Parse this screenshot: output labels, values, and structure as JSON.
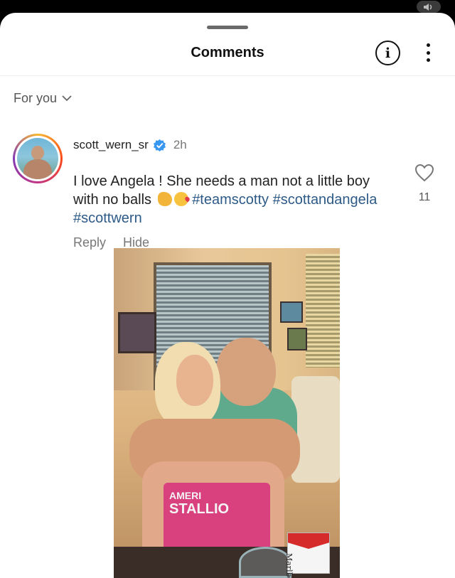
{
  "status_bar": {
    "volume_icon": "speaker-icon"
  },
  "header": {
    "title": "Comments",
    "info_icon_glyph": "i",
    "info_icon": "info-icon",
    "more_icon": "more-vertical-icon"
  },
  "filter": {
    "label": "For you",
    "icon": "chevron-down-icon"
  },
  "comment": {
    "username": "scott_wern_sr",
    "verified": true,
    "time": "2h",
    "text_line1": "I love Angela ! She needs a man not a little boy with no balls",
    "emojis": [
      "flexed-biceps",
      "face-blowing-kiss"
    ],
    "hashtags": [
      "#teamscotty",
      "#scottandangela",
      "#scottwern"
    ],
    "likes": "11",
    "reply_label": "Reply",
    "hide_label": "Hide"
  },
  "photo": {
    "shirt_text_line1": "AMERI",
    "shirt_text_line2": "STALLIO",
    "pack_text": "Marlboro"
  },
  "colors": {
    "hashtag": "#2d5a87",
    "verified": "#3897f0",
    "secondary_text": "#777777"
  }
}
